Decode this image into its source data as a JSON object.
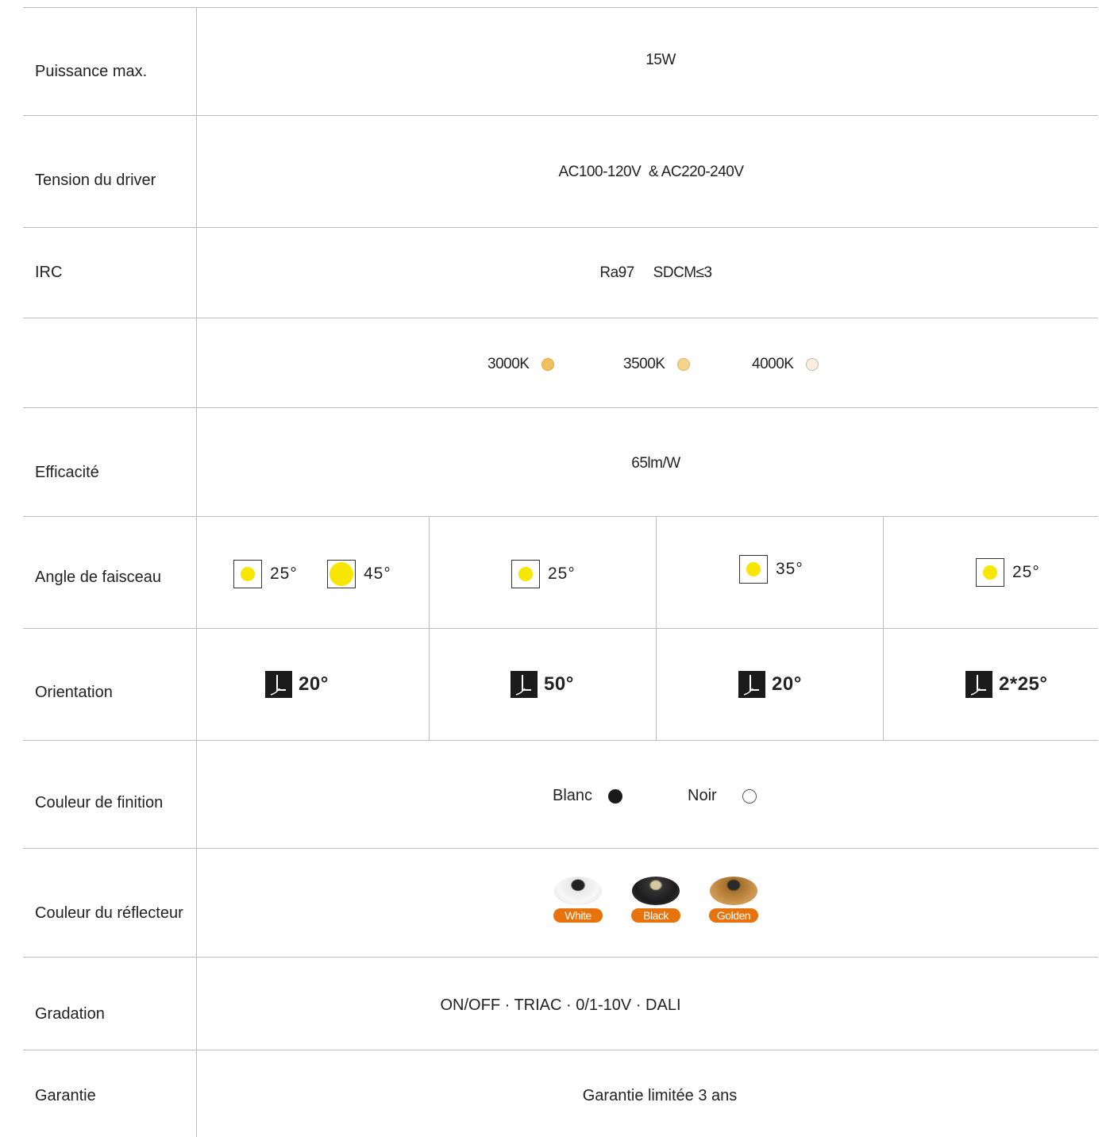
{
  "rows": {
    "puissance": {
      "label": "Puissance max.",
      "value": "15W"
    },
    "tension": {
      "label": "Tension du driver",
      "value": "AC100-120V  & AC220-240V"
    },
    "irc": {
      "label": "IRC",
      "value": "Ra97     SDCM≤3"
    },
    "cct": {
      "label": "",
      "options": [
        {
          "label": "3000K",
          "color": "#f2c15f"
        },
        {
          "label": "3500K",
          "color": "#f4d38c"
        },
        {
          "label": "4000K",
          "color": "#fbeedd"
        }
      ]
    },
    "efficacite": {
      "label": "Efficacité",
      "value": "65lm/W"
    },
    "angle": {
      "label": "Angle de faisceau",
      "values": [
        "25°",
        "45°",
        "25°",
        "35°",
        "25°"
      ]
    },
    "orientation": {
      "label": "Orientation",
      "values": [
        "20°",
        "50°",
        "20°",
        "2*25°"
      ]
    },
    "finition": {
      "label": "Couleur de finition",
      "options": [
        {
          "label": "Blanc",
          "color": "#1a1a1a"
        },
        {
          "label": "Noir",
          "color": "#ffffff"
        }
      ]
    },
    "reflecteur": {
      "label": "Couleur du réflecteur",
      "options": [
        {
          "label": "White",
          "color": "#f2f2f2"
        },
        {
          "label": "Black",
          "color": "#1c1c1c"
        },
        {
          "label": "Golden",
          "color": "#c9914a"
        }
      ]
    },
    "gradation": {
      "label": "Gradation",
      "value": "ON/OFF · TRIAC · 0/1-10V · DALI"
    },
    "garantie": {
      "label": "Garantie",
      "value": "Garantie limitée 3 ans"
    }
  },
  "colors": {
    "accent": "#e8720c",
    "beam": "#f7e600",
    "grid": "#bdbdbd"
  }
}
